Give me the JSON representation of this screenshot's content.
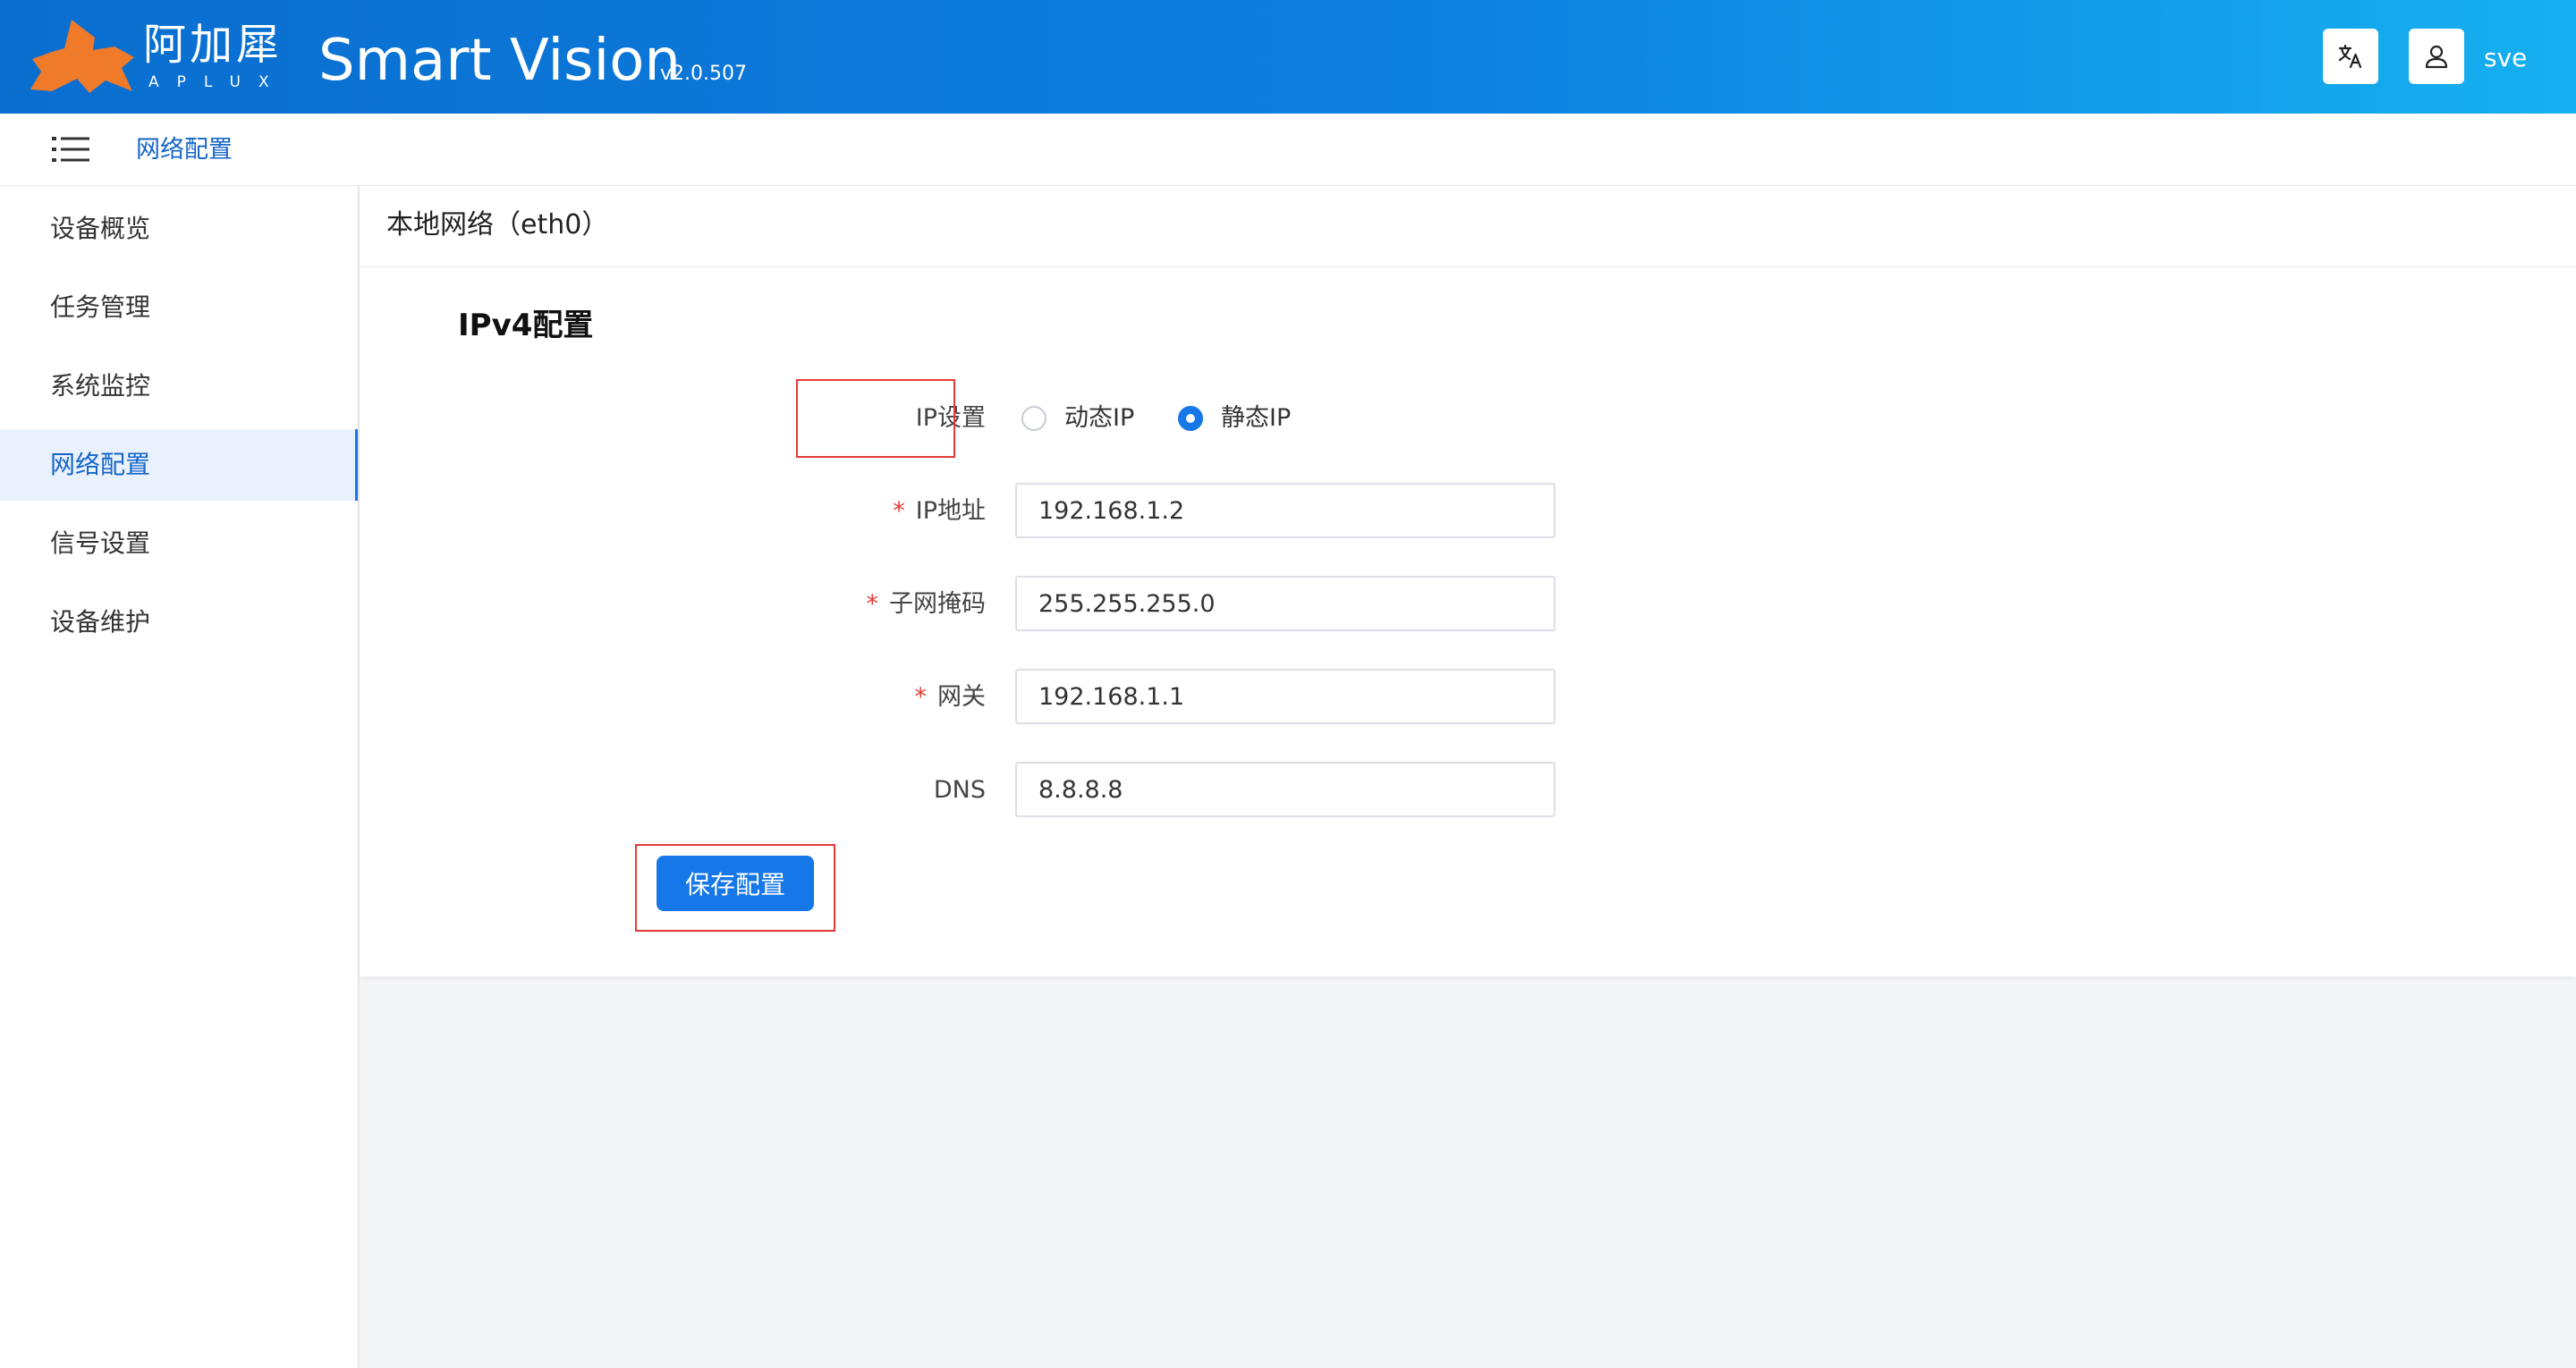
{
  "header": {
    "logo_cn": "阿加犀",
    "logo_en": "APLUX",
    "title": "Smart Vision",
    "version": "v2.0.507",
    "username": "sve",
    "lang_icon": "translate-icon",
    "user_icon": "user-icon"
  },
  "breadcrumb": {
    "current": "网络配置"
  },
  "sidebar": {
    "items": [
      {
        "label": "设备概览",
        "active": false
      },
      {
        "label": "任务管理",
        "active": false
      },
      {
        "label": "系统监控",
        "active": false
      },
      {
        "label": "网络配置",
        "active": true
      },
      {
        "label": "信号设置",
        "active": false
      },
      {
        "label": "设备维护",
        "active": false
      }
    ]
  },
  "panel": {
    "title": "本地网络（eth0）",
    "section_title": "IPv4配置",
    "ip_mode": {
      "label": "IP设置",
      "options": [
        "动态IP",
        "静态IP"
      ],
      "selected": "静态IP"
    },
    "fields": {
      "ip": {
        "label": "IP地址",
        "value": "192.168.1.2",
        "required": true
      },
      "mask": {
        "label": "子网掩码",
        "value": "255.255.255.0",
        "required": true
      },
      "gateway": {
        "label": "网关",
        "value": "192.168.1.1",
        "required": true
      },
      "dns": {
        "label": "DNS",
        "value": "8.8.8.8",
        "required": false
      }
    },
    "save_label": "保存配置"
  },
  "colors": {
    "header_start": "#0a6ecf",
    "header_end": "#16b0f0",
    "accent": "#1677e8",
    "highlight": "#e53935",
    "logo": "#ee7a2a"
  }
}
